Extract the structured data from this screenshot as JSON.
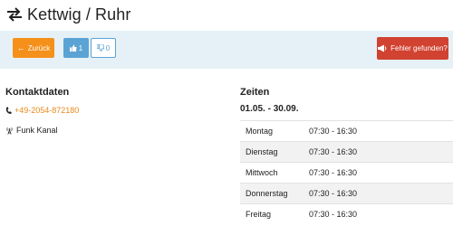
{
  "header": {
    "title": "Kettwig / Ruhr",
    "icon": "swap-arrows-icon"
  },
  "toolbar": {
    "back_label": "Zurück",
    "like_count": "1",
    "dislike_count": "0",
    "error_label": "Fehler gefunden?",
    "colors": {
      "back": "#f5901a",
      "like": "#5aa3d4",
      "error": "#d14230",
      "bar": "#e6f1f7"
    }
  },
  "contact": {
    "heading": "Kontaktdaten",
    "phone": "+49-2054-872180",
    "radio_label": "Funk Kanal"
  },
  "hours": {
    "heading": "Zeiten",
    "season": "01.05. - 30.09.",
    "rows": [
      {
        "day": "Montag",
        "time": "07:30 - 16:30"
      },
      {
        "day": "Dienstag",
        "time": "07:30 - 16:30"
      },
      {
        "day": "Mittwoch",
        "time": "07:30 - 16:30"
      },
      {
        "day": "Donnerstag",
        "time": "07:30 - 16:30"
      },
      {
        "day": "Freitag",
        "time": "07:30 - 16:30"
      }
    ]
  }
}
